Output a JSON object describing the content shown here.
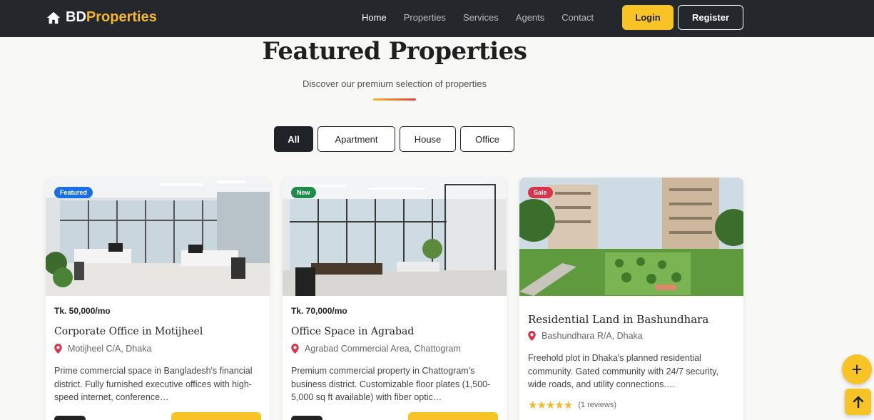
{
  "brand": {
    "part1": "BD",
    "part2": "Properties"
  },
  "nav": {
    "links": [
      "Home",
      "Properties",
      "Services",
      "Agents",
      "Contact"
    ],
    "active": "Home",
    "login": "Login",
    "register": "Register"
  },
  "section": {
    "title": "Featured Properties",
    "subtitle": "Discover our premium selection of properties"
  },
  "filters": [
    "All",
    "Apartment",
    "House",
    "Office"
  ],
  "active_filter": "All",
  "cards": [
    {
      "badge": "Featured",
      "price": "Tk. 50,000/mo",
      "title": "Corporate Office in Motijheel",
      "location": "Motijheel C/A, Dhaka",
      "description": "Prime commercial space in Bangladesh's financial district. Fully furnished executive offices with high-speed internet, conference…"
    },
    {
      "badge": "New",
      "price": "Tk. 70,000/mo",
      "title": "Office Space in Agrabad",
      "location": "Agrabad Commercial Area, Chattogram",
      "description": "Premium commercial property in Chattogram's business district. Customizable floor plates (1,500-5,000 sq ft available) with fiber optic…"
    },
    {
      "badge": "Sale",
      "title": "Residential Land in Bashundhara",
      "location": "Bashundhara R/A, Dhaka",
      "description": "Freehold plot in Dhaka's planned residential community. Gated community with 24/7 security, wide roads, and utility connections.…",
      "rating": 5,
      "reviews": "(1 reviews)"
    }
  ],
  "colors": {
    "accent": "#f7c325",
    "nav_bg": "#24272b"
  }
}
